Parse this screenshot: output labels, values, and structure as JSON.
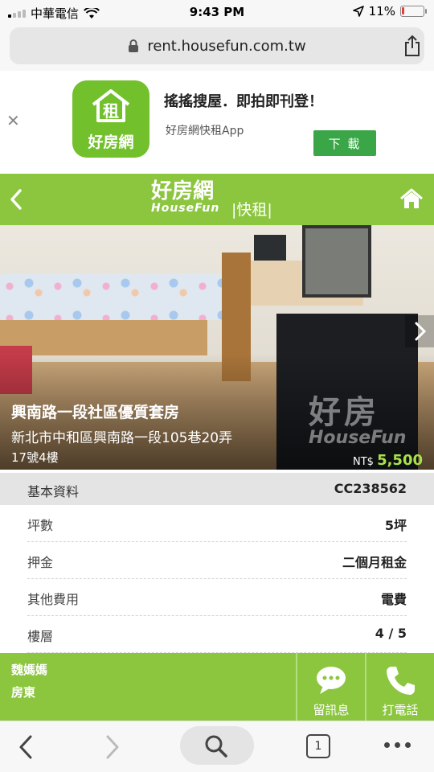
{
  "status_bar": {
    "carrier": "中華電信",
    "time": "9:43 PM",
    "battery": "11%",
    "battery_level": 0.11
  },
  "browser": {
    "url": "rent.housefun.com.tw",
    "tab_count": "1"
  },
  "app_banner": {
    "icon_char": "租",
    "icon_name": "好房網",
    "title": "搖搖搜屋．即拍即刊登！",
    "subtitle": "好房網快租App",
    "download_label": "下 載"
  },
  "site_header": {
    "logo_main": "好房網",
    "logo_en": "HouseFun",
    "section": "|快租|"
  },
  "listing": {
    "title": "興南路一段社區優質套房",
    "address_line1": "新北市中和區興南路一段105巷20弄",
    "address_line2": "17號4樓",
    "price_currency": "NT$",
    "price_value": "5,500",
    "watermark_1": "好房",
    "watermark_2": "HouseFun"
  },
  "info": {
    "header_label": "基本資料",
    "listing_id": "CC238562",
    "rows": [
      {
        "label": "坪數",
        "value": "5坪"
      },
      {
        "label": "押金",
        "value": "二個月租金"
      },
      {
        "label": "其他費用",
        "value": "電費"
      },
      {
        "label": "樓層",
        "value": "4 / 5"
      }
    ]
  },
  "contact": {
    "name": "魏媽媽",
    "role": "房東",
    "message_label": "留訊息",
    "call_label": "打電話"
  },
  "colors": {
    "brand_green": "#8cc63f",
    "download_green": "#3aa648",
    "price_green": "#a8e14b"
  }
}
